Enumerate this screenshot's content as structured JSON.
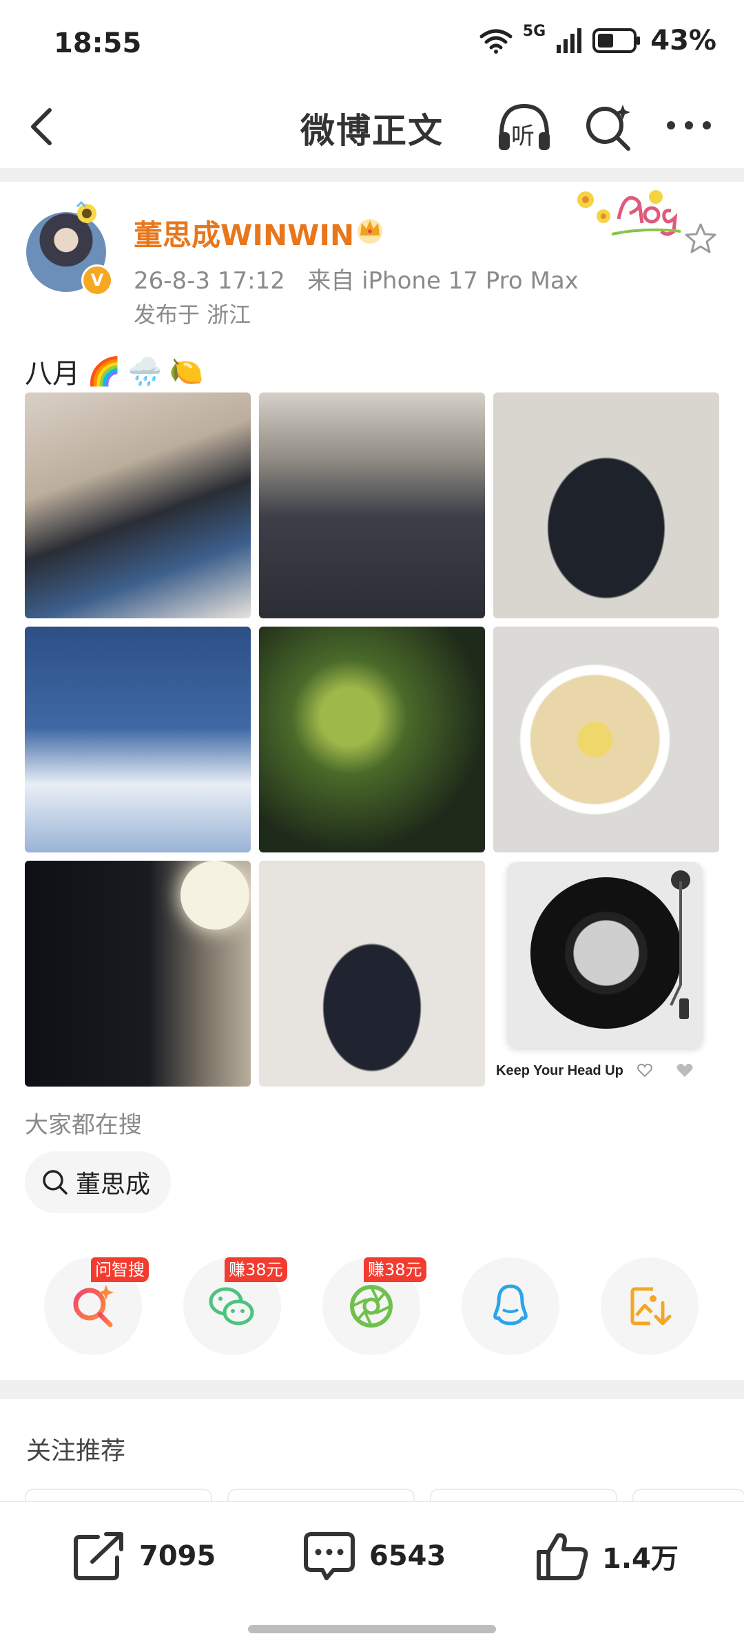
{
  "status_bar": {
    "time": "18:55",
    "network": "5G",
    "battery": "43%"
  },
  "nav": {
    "title": "微博正文",
    "listen_label": "听"
  },
  "author": {
    "name": "董思成WINWIN",
    "verified_badge": "V",
    "timestamp": "26-8-3 17:12",
    "source": "来自 iPhone 17 Pro Max",
    "location": "发布于 浙江"
  },
  "post": {
    "text": "八月",
    "emojis": [
      "🌈",
      "🌧️",
      "🍋"
    ]
  },
  "music_card": {
    "title": "Keep Your Head Up"
  },
  "search_section": {
    "heading": "大家都在搜",
    "chip_label": "董思成"
  },
  "share_row": {
    "badges": [
      "问智搜",
      "赚38元",
      "赚38元"
    ],
    "icons": [
      "smart-search-icon",
      "wechat-icon",
      "moments-icon",
      "qq-icon",
      "save-image-icon"
    ]
  },
  "follow_section": {
    "heading": "关注推荐"
  },
  "actions": {
    "repost_count": "7095",
    "comment_count": "6543",
    "like_count": "1.4万"
  },
  "colors": {
    "author_name": "#e8761b",
    "badge_red": "#f13c2f",
    "verified": "#f6a821"
  }
}
